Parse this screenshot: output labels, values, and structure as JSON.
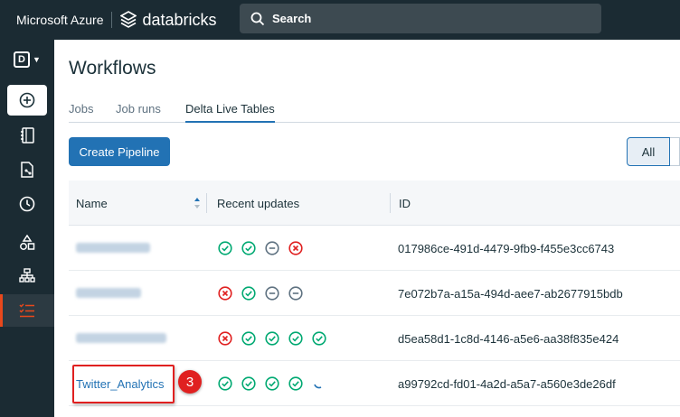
{
  "header": {
    "azure_label": "Microsoft Azure",
    "databricks_label": "databricks",
    "search_label": "Search"
  },
  "sidebar": {
    "workspace_letter": "D",
    "items": [
      "new-icon",
      "notebook-icon",
      "data-icon",
      "history-icon",
      "shapes-icon",
      "compute-icon",
      "workflows-icon"
    ]
  },
  "page": {
    "title": "Workflows",
    "tabs": [
      {
        "label": "Jobs"
      },
      {
        "label": "Job runs"
      },
      {
        "label": "Delta Live Tables",
        "active": true
      }
    ],
    "create_button": "Create Pipeline",
    "filter_all": "All"
  },
  "table": {
    "headers": {
      "name": "Name",
      "updates": "Recent updates",
      "id": "ID"
    },
    "rows": [
      {
        "name": "",
        "name_blurred": true,
        "updates": [
          "success",
          "success",
          "canceled",
          "failed"
        ],
        "id": "017986ce-491d-4479-9fb9-f455e3cc6743"
      },
      {
        "name": "",
        "name_blurred": true,
        "updates": [
          "failed",
          "success",
          "canceled",
          "canceled"
        ],
        "id": "7e072b7a-a15a-494d-aee7-ab2677915bdb"
      },
      {
        "name": "",
        "name_blurred": true,
        "updates": [
          "failed",
          "success",
          "success",
          "success",
          "success"
        ],
        "id": "d5ea58d1-1c8d-4146-a5e6-aa38f835e424"
      },
      {
        "name": "Twitter_Analytics",
        "name_blurred": false,
        "updates": [
          "success",
          "success",
          "success",
          "success",
          "running"
        ],
        "id": "a99792cd-fd01-4a2d-a5a7-a560e3de26df"
      }
    ]
  },
  "annotation": {
    "marker_number": "3"
  },
  "colors": {
    "accent": "#2272b4",
    "success": "#00a972",
    "failed": "#e02020",
    "canceled": "#5f7281",
    "highlight": "#e02020"
  }
}
